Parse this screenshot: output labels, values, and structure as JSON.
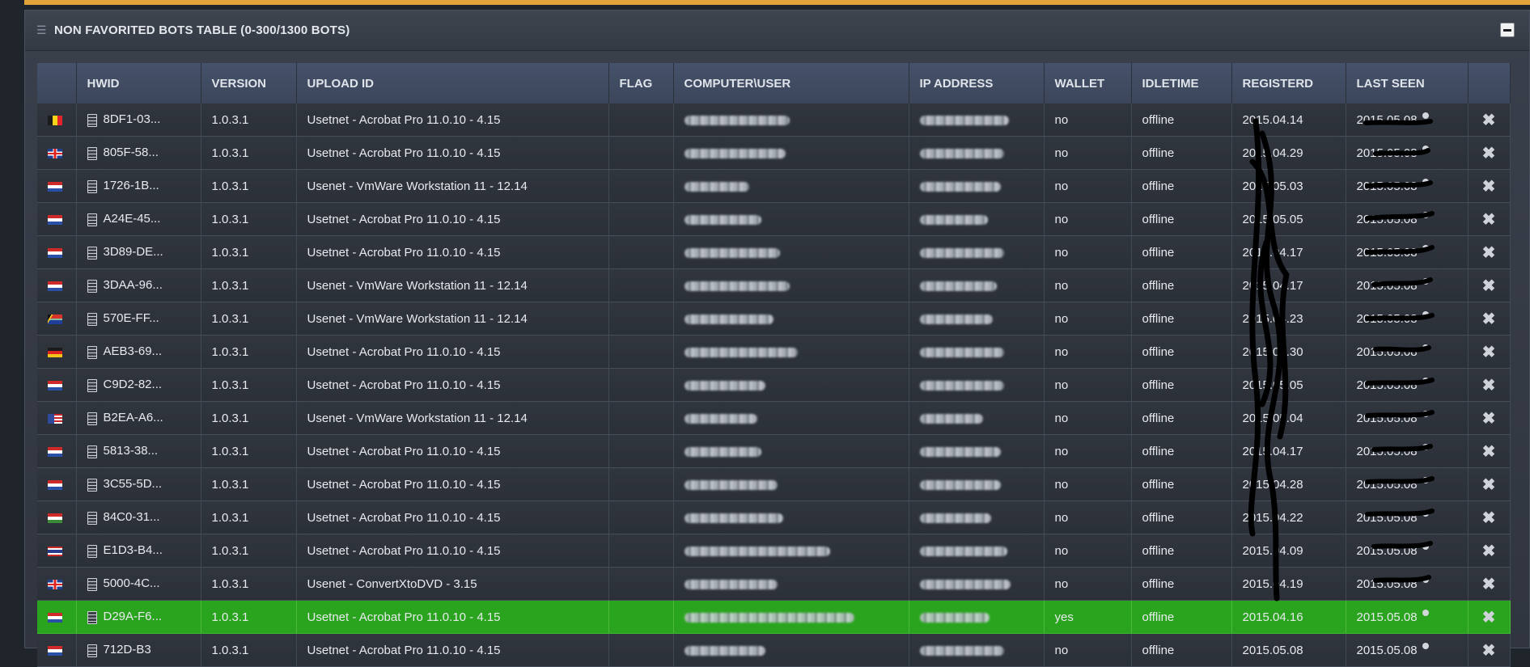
{
  "panel": {
    "title": "NON FAVORITED BOTS TABLE (0-300/1300 BOTS)"
  },
  "columns": [
    "",
    "HWID",
    "VERSION",
    "UPLOAD ID",
    "FLAG",
    "COMPUTER\\USER",
    "IP ADDRESS",
    "WALLET",
    "IDLETIME",
    "REGISTERD",
    "LAST SEEN",
    ""
  ],
  "rows": [
    {
      "flag": "be",
      "hwid": "8DF1-03...",
      "version": "1.0.3.1",
      "upload": "Usetnet - Acrobat Pro 11.0.10 - 4.15",
      "wallet": "no",
      "idle": "offline",
      "registered": "2015.04.14",
      "last_seen": "2015.05.08"
    },
    {
      "flag": "gb",
      "hwid": "805F-58...",
      "version": "1.0.3.1",
      "upload": "Usetnet - Acrobat Pro 11.0.10 - 4.15",
      "wallet": "no",
      "idle": "offline",
      "registered": "2015.04.29",
      "last_seen": "2015.05.08"
    },
    {
      "flag": "nl",
      "hwid": "1726-1B...",
      "version": "1.0.3.1",
      "upload": "Usenet - VmWare Workstation 11 - 12.14",
      "wallet": "no",
      "idle": "offline",
      "registered": "2015.05.03",
      "last_seen": "2015.05.08"
    },
    {
      "flag": "nl",
      "hwid": "A24E-45...",
      "version": "1.0.3.1",
      "upload": "Usetnet - Acrobat Pro 11.0.10 - 4.15",
      "wallet": "no",
      "idle": "offline",
      "registered": "2015.05.05",
      "last_seen": "2015.05.08"
    },
    {
      "flag": "nl",
      "hwid": "3D89-DE...",
      "version": "1.0.3.1",
      "upload": "Usetnet - Acrobat Pro 11.0.10 - 4.15",
      "wallet": "no",
      "idle": "offline",
      "registered": "2015.04.17",
      "last_seen": "2015.05.08"
    },
    {
      "flag": "nl",
      "hwid": "3DAA-96...",
      "version": "1.0.3.1",
      "upload": "Usenet - VmWare Workstation 11 - 12.14",
      "wallet": "no",
      "idle": "offline",
      "registered": "2015.04.17",
      "last_seen": "2015.05.08"
    },
    {
      "flag": "za",
      "hwid": "570E-FF...",
      "version": "1.0.3.1",
      "upload": "Usenet - VmWare Workstation 11 - 12.14",
      "wallet": "no",
      "idle": "offline",
      "registered": "2015.04.23",
      "last_seen": "2015.05.08"
    },
    {
      "flag": "de",
      "hwid": "AEB3-69...",
      "version": "1.0.3.1",
      "upload": "Usetnet - Acrobat Pro 11.0.10 - 4.15",
      "wallet": "no",
      "idle": "offline",
      "registered": "2015.04.30",
      "last_seen": "2015.05.08"
    },
    {
      "flag": "nl",
      "hwid": "C9D2-82...",
      "version": "1.0.3.1",
      "upload": "Usetnet - Acrobat Pro 11.0.10 - 4.15",
      "wallet": "no",
      "idle": "offline",
      "registered": "2015.05.05",
      "last_seen": "2015.05.08"
    },
    {
      "flag": "us",
      "hwid": "B2EA-A6...",
      "version": "1.0.3.1",
      "upload": "Usenet - VmWare Workstation 11 - 12.14",
      "wallet": "no",
      "idle": "offline",
      "registered": "2015.05.04",
      "last_seen": "2015.05.08"
    },
    {
      "flag": "nl",
      "hwid": "5813-38...",
      "version": "1.0.3.1",
      "upload": "Usetnet - Acrobat Pro 11.0.10 - 4.15",
      "wallet": "no",
      "idle": "offline",
      "registered": "2015.04.17",
      "last_seen": "2015.05.08"
    },
    {
      "flag": "nl",
      "hwid": "3C55-5D...",
      "version": "1.0.3.1",
      "upload": "Usetnet - Acrobat Pro 11.0.10 - 4.15",
      "wallet": "no",
      "idle": "offline",
      "registered": "2015.04.28",
      "last_seen": "2015.05.08"
    },
    {
      "flag": "hu",
      "hwid": "84C0-31...",
      "version": "1.0.3.1",
      "upload": "Usetnet - Acrobat Pro 11.0.10 - 4.15",
      "wallet": "no",
      "idle": "offline",
      "registered": "2015.04.22",
      "last_seen": "2015.05.08"
    },
    {
      "flag": "th",
      "hwid": "E1D3-B4...",
      "version": "1.0.3.1",
      "upload": "Usetnet - Acrobat Pro 11.0.10 - 4.15",
      "wallet": "no",
      "idle": "offline",
      "registered": "2015.04.09",
      "last_seen": "2015.05.08"
    },
    {
      "flag": "gb",
      "hwid": "5000-4C...",
      "version": "1.0.3.1",
      "upload": "Usenet - ConvertXtoDVD - 3.15",
      "wallet": "no",
      "idle": "offline",
      "registered": "2015.04.19",
      "last_seen": "2015.05.08"
    },
    {
      "flag": "nl",
      "hwid": "D29A-F6...",
      "version": "1.0.3.1",
      "upload": "Usetnet - Acrobat Pro 11.0.10 - 4.15",
      "wallet": "yes",
      "idle": "offline",
      "registered": "2015.04.16",
      "last_seen": "2015.05.08",
      "highlight": true
    },
    {
      "flag": "nl",
      "hwid": "712D-B3",
      "version": "1.0.3.1",
      "upload": "Usetnet - Acrobat Pro 11.0.10 - 4.15",
      "wallet": "no",
      "idle": "offline",
      "registered": "2015.05.08",
      "last_seen": "2015.05.08"
    }
  ],
  "colors": {
    "accent_bar": "#e1a43a",
    "highlight_row": "#2aa41e",
    "header_bg": "#3b465a"
  },
  "icons": {
    "row_icon": "document-icon",
    "delete": "close-icon",
    "status": "status-dot-icon",
    "collapse": "minus-icon"
  }
}
